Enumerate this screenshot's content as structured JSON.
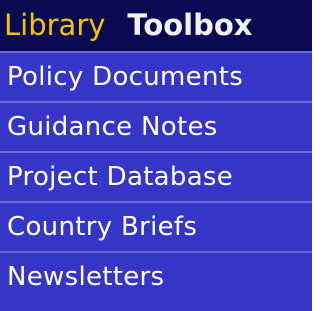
{
  "tabs": [
    {
      "label": "Library",
      "active": true
    },
    {
      "label": "Toolbox",
      "active": false
    }
  ],
  "menu": {
    "items": [
      {
        "label": "Policy Documents"
      },
      {
        "label": "Guidance Notes"
      },
      {
        "label": "Project Database"
      },
      {
        "label": "Country Briefs"
      },
      {
        "label": "Newsletters"
      }
    ]
  },
  "colors": {
    "header_bg": "#0a0a52",
    "menu_bg": "#3535c8",
    "active_tab": "#f5c400",
    "inactive_tab": "#f2f2f2",
    "item_text": "#ffffff",
    "divider": "#6a6ad8"
  }
}
